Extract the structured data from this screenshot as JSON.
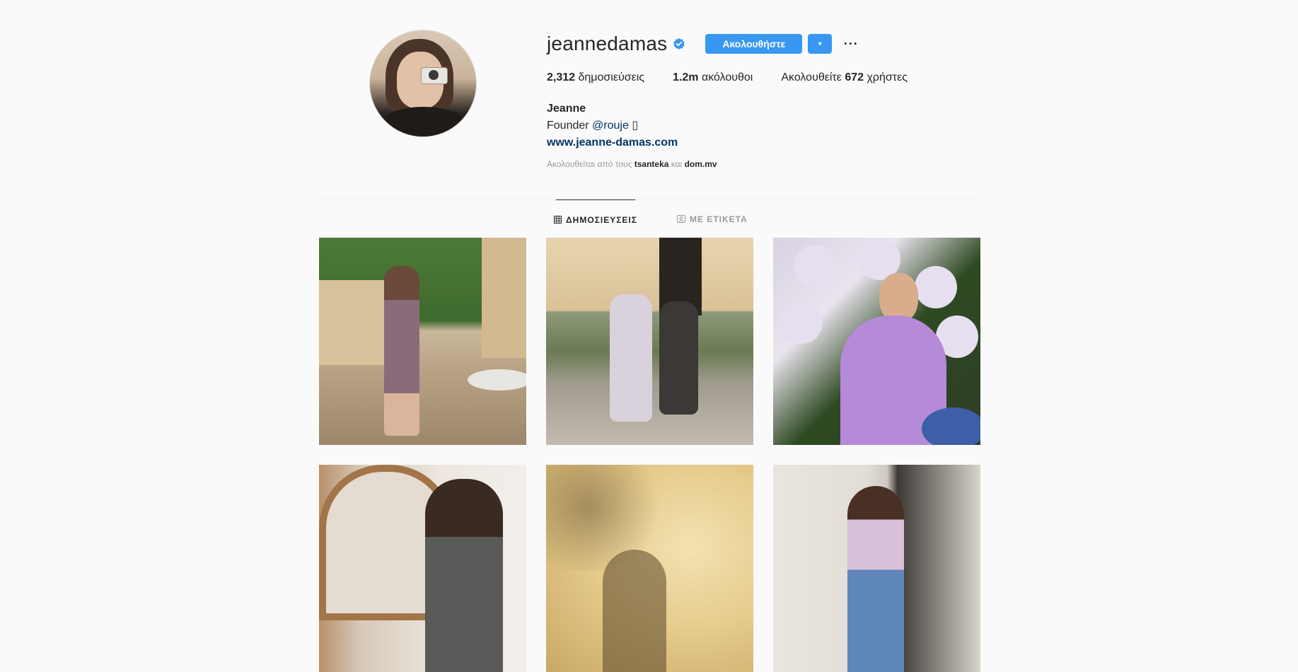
{
  "profile": {
    "username": "jeannedamas",
    "follow_label": "Ακολουθήστε",
    "dropdown_glyph": "▾",
    "more_glyph": "···",
    "verified_color": "#3897f0"
  },
  "stats": {
    "posts_count": "2,312",
    "posts_label": "δημοσιεύσεις",
    "followers_count": "1.2m",
    "followers_label": "ακόλουθοι",
    "following_prefix": "Ακολουθείτε",
    "following_count": "672",
    "following_suffix": "χρήστες"
  },
  "bio": {
    "name": "Jeanne",
    "line_prefix": "Founder",
    "handle": "@rouje",
    "emoji": "▯",
    "website": "www.jeanne-damas.com"
  },
  "followed_by": {
    "prefix": "Ακολουθείται από τους",
    "user1": "tsanteka",
    "conj": "και",
    "user2": "dom.mv"
  },
  "tabs": {
    "posts_label": "ΔΗΜΟΣΙΕΥΣΕΙΣ",
    "tagged_label": "ΜΕ ΕΤΙΚΕΤΑ"
  },
  "colors": {
    "accent": "#3897f0",
    "link": "#003569"
  }
}
